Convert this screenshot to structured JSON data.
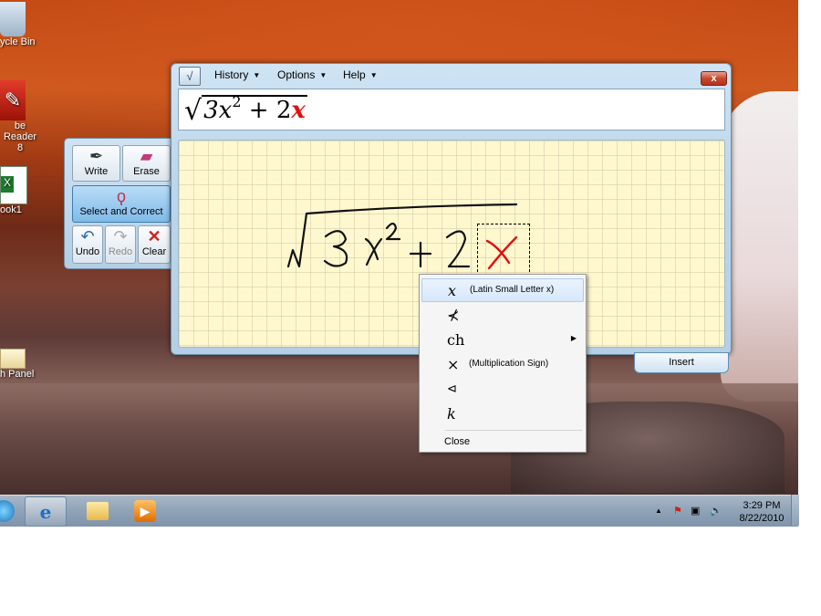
{
  "desktop": {
    "icons": [
      {
        "label": "ycle Bin",
        "glyph": "recycle-bin-icon"
      },
      {
        "label": "be Reader 8",
        "glyph": "adobe-reader-icon"
      },
      {
        "label": "ook1",
        "glyph": "excel-workbook-icon"
      },
      {
        "label": "h Panel",
        "glyph": "control-panel-icon"
      }
    ]
  },
  "window": {
    "menus": [
      "History",
      "Options",
      "Help"
    ],
    "close_label": "x",
    "preview": {
      "radical_body": "3x",
      "exponent": "2",
      "plus_two": " + 2",
      "highlight": "x"
    },
    "insert_label": "Insert"
  },
  "tools": {
    "write": "Write",
    "erase": "Erase",
    "select": "Select and Correct",
    "undo": "Undo",
    "redo": "Redo",
    "clear": "Clear"
  },
  "context_menu": {
    "items": [
      {
        "symbol": "x",
        "desc": "(Latin Small Letter x)"
      },
      {
        "symbol": "⊀",
        "desc": ""
      },
      {
        "symbol": "ch",
        "desc": ""
      },
      {
        "symbol": "×",
        "desc": "(Multiplication Sign)"
      },
      {
        "symbol": "⊲",
        "desc": ""
      },
      {
        "symbol": "k",
        "desc": ""
      }
    ],
    "close": "Close"
  },
  "taskbar": {
    "time": "3:29 PM",
    "date": "8/22/2010"
  },
  "colors": {
    "accent_red": "#e01010",
    "canvas_bg": "#fff8cf",
    "taskbar": "#91a4b8"
  }
}
